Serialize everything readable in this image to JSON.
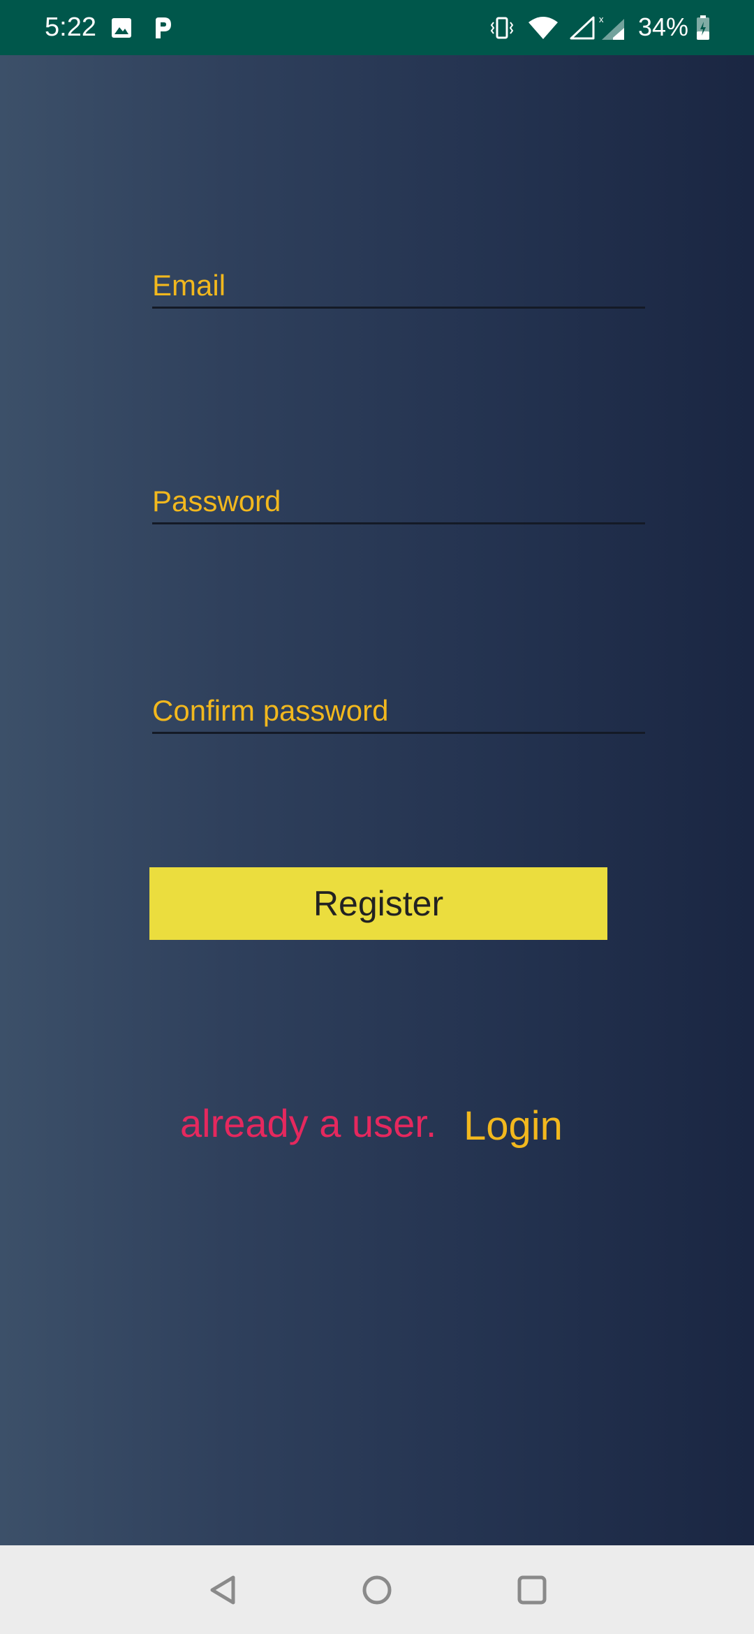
{
  "status_bar": {
    "time": "5:22",
    "battery_percent": "34%",
    "icons": [
      "image-icon",
      "p-app-icon",
      "vibrate-icon",
      "wifi-icon",
      "signal-icon",
      "signal-x-icon",
      "battery-icon"
    ],
    "background_color": "#00574b"
  },
  "form": {
    "email_placeholder": "Email",
    "password_placeholder": "Password",
    "confirm_password_placeholder": "Confirm password",
    "register_label": "Register"
  },
  "footer": {
    "already_user_text": "already a user.",
    "login_label": "Login"
  },
  "nav_bar": {
    "buttons": [
      "back-icon",
      "home-icon",
      "recents-icon"
    ]
  },
  "colors": {
    "accent_yellow": "#f2b81e",
    "button_yellow": "#ebdd3e",
    "pink_text": "#e5285e",
    "gradient_start": "#3c5069",
    "gradient_end": "#1a2642"
  }
}
